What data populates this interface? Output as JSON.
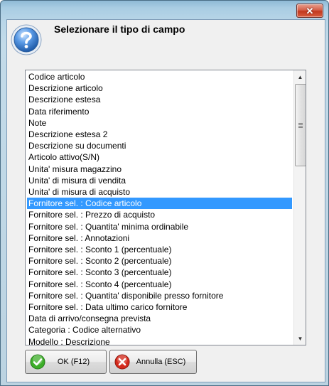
{
  "window": {
    "close_glyph": "✕",
    "close_icon": "close-icon"
  },
  "header": {
    "title": "Selezionare il tipo di campo",
    "icon": "question-icon"
  },
  "list": {
    "selected_index": 11,
    "items": [
      "Codice articolo",
      "Descrizione articolo",
      "Descrizione estesa",
      "Data riferimento",
      "Note",
      "Descrizione estesa 2",
      "Descrizione su documenti",
      "Articolo attivo(S/N)",
      "Unita' misura magazzino",
      "Unita' di misura di vendita",
      "Unita' di misura di acquisto",
      "Fornitore sel. : Codice articolo",
      "Fornitore sel. : Prezzo di acquisto",
      "Fornitore sel. : Quantita' minima ordinabile",
      "Fornitore sel. : Annotazioni",
      "Fornitore sel. : Sconto 1 (percentuale)",
      "Fornitore sel. : Sconto 2 (percentuale)",
      "Fornitore sel. : Sconto 3 (percentuale)",
      "Fornitore sel. : Sconto 4 (percentuale)",
      "Fornitore sel. : Quantita' disponibile presso fornitore",
      "Fornitore sel. : Data ultimo carico fornitore",
      "Data di arrivo/consegna prevista",
      "Categoria : Codice alternativo",
      "Modello : Descrizione"
    ]
  },
  "buttons": {
    "ok_label": "OK (F12)",
    "ok_icon": "check-icon",
    "cancel_label": "Annulla (ESC)",
    "cancel_icon": "cancel-icon"
  },
  "colors": {
    "selection": "#3399ff",
    "ok_green": "#3cae28",
    "cancel_red": "#d42a1c",
    "help_blue": "#2d6fc7"
  }
}
